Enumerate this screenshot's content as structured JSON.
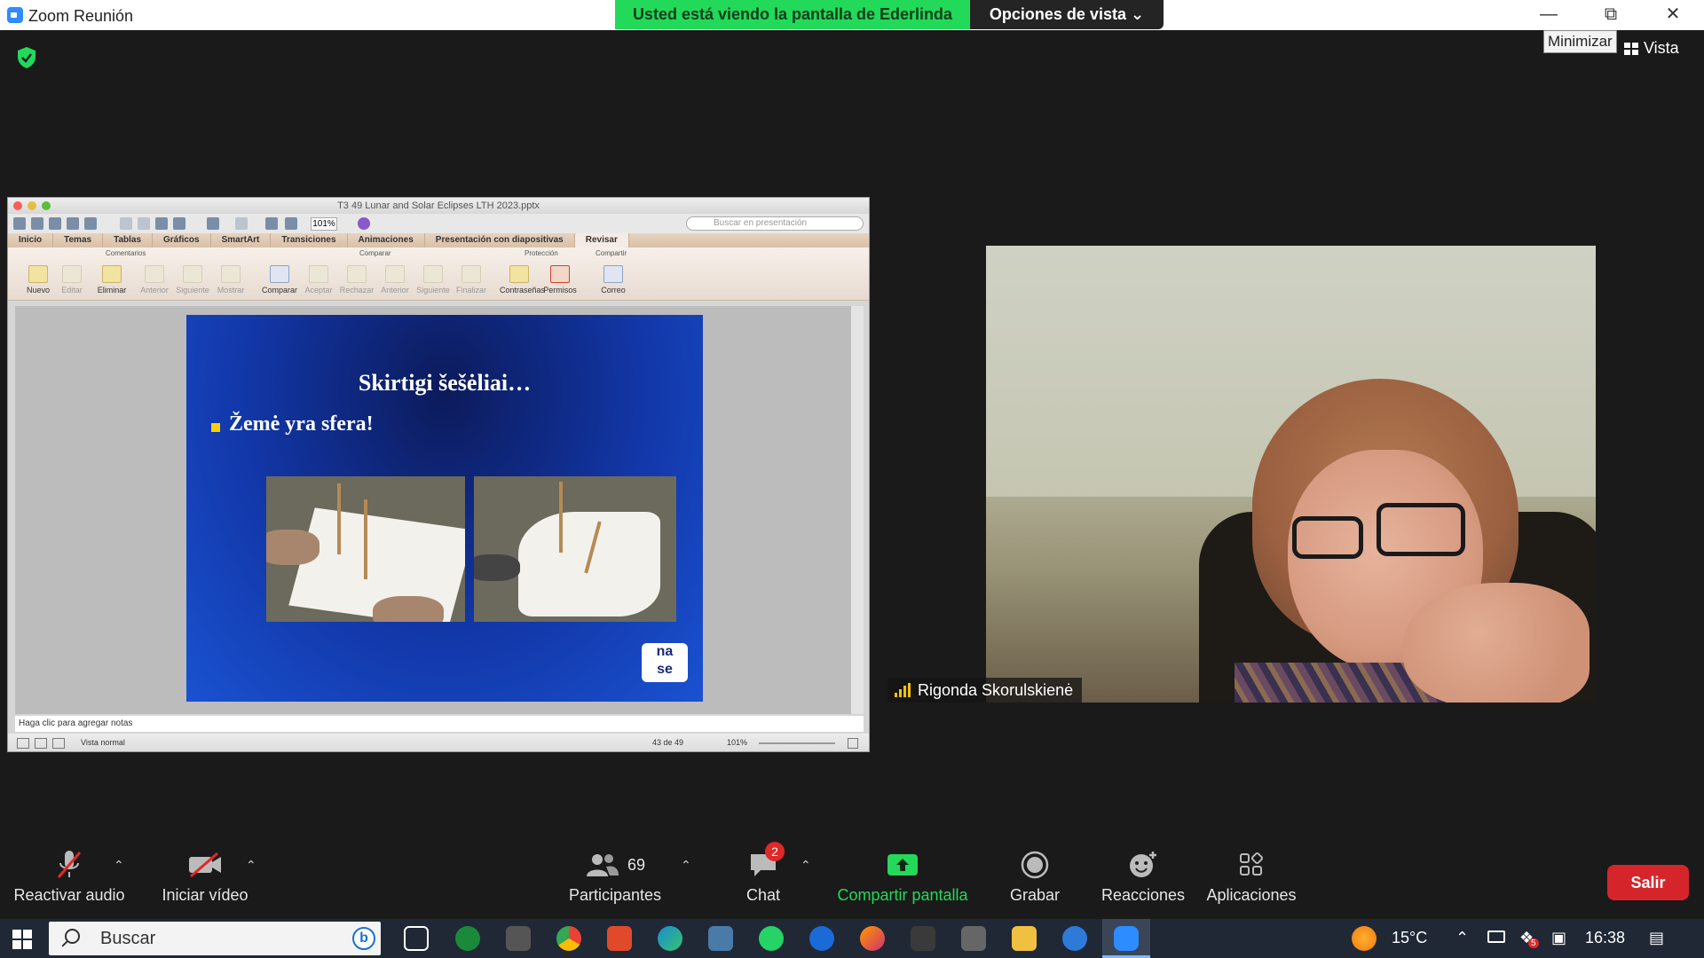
{
  "zoom": {
    "window_title": "Zoom Reunión",
    "share_banner": "Usted está viendo la pantalla de Ederlinda",
    "view_options": "Opciones de vista",
    "tooltip": "Minimizar",
    "view_button": "Vista",
    "participant_name": "Rigonda Skorulskienė",
    "controls": {
      "audio": "Reactivar audio",
      "video": "Iniciar vídeo",
      "participants": "Participantes",
      "participants_count": "69",
      "chat": "Chat",
      "chat_badge": "2",
      "share": "Compartir pantalla",
      "record": "Grabar",
      "reactions": "Reacciones",
      "apps": "Aplicaciones",
      "leave": "Salir"
    }
  },
  "ppt": {
    "file_title": "T3 49 Lunar and Solar Eclipses LTH 2023.pptx",
    "zoom": "101%",
    "search_placeholder": "Buscar en presentación",
    "tabs": [
      "Inicio",
      "Temas",
      "Tablas",
      "Gráficos",
      "SmartArt",
      "Transiciones",
      "Animaciones",
      "Presentación con diapositivas",
      "Revisar"
    ],
    "groups": {
      "comments": "Comentarios",
      "compare": "Comparar",
      "protection": "Protección",
      "share": "Compartir"
    },
    "buttons": [
      "Nuevo",
      "Editar",
      "Eliminar",
      "Anterior",
      "Siguiente",
      "Mostrar",
      "Comparar",
      "Aceptar",
      "Rechazar",
      "Anterior",
      "Siguiente",
      "Finalizar",
      "Contraseñas",
      "Permisos",
      "Correo"
    ],
    "slide_title": "Skirtigi šešėliai…",
    "slide_bullet": "Žemė yra sfera!",
    "logo_text": "na\nse",
    "notes_placeholder": "Haga clic para agregar notas",
    "view_mode": "Vista normal",
    "slide_counter": "43 de 49",
    "status_zoom": "101%"
  },
  "taskbar": {
    "search": "Buscar",
    "temperature": "15°C",
    "time": "16:38",
    "notification_badge": "5"
  },
  "colors": {
    "share_green": "#23d959",
    "leave_red": "#d5252b",
    "zoom_blue": "#2d8cff"
  }
}
